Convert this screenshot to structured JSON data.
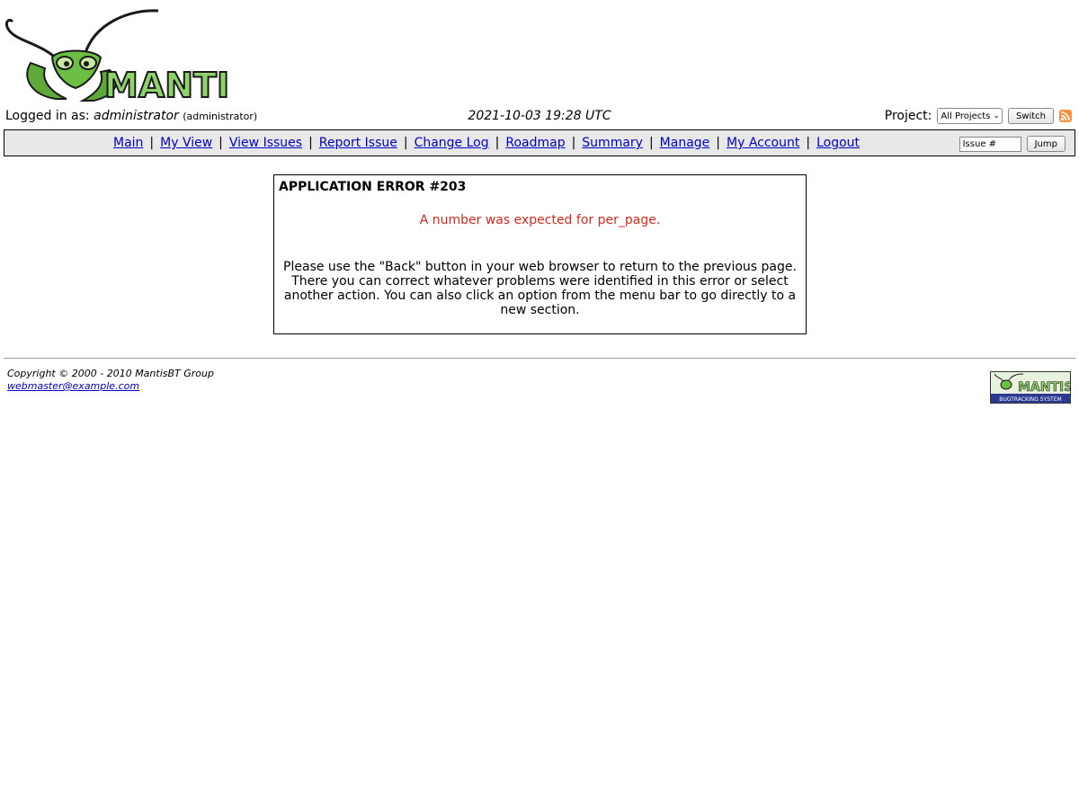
{
  "logo": {
    "text": "MANTIS"
  },
  "login": {
    "prefix": "Logged in as:",
    "username": "administrator",
    "role": "(administrator)"
  },
  "datetime": "2021-10-03 19:28 UTC",
  "project": {
    "label": "Project:",
    "selected": "All Projects",
    "switch_label": "Switch"
  },
  "menu": {
    "items": [
      {
        "label": "Main"
      },
      {
        "label": "My View"
      },
      {
        "label": "View Issues"
      },
      {
        "label": "Report Issue"
      },
      {
        "label": "Change Log"
      },
      {
        "label": "Roadmap"
      },
      {
        "label": "Summary"
      },
      {
        "label": "Manage"
      },
      {
        "label": "My Account"
      },
      {
        "label": "Logout"
      }
    ],
    "separator": "|",
    "issue_placeholder": "Issue #",
    "jump_label": "Jump"
  },
  "error": {
    "title": "APPLICATION ERROR #203",
    "message": "A number was expected for per_page.",
    "help": "Please use the \"Back\" button in your web browser to return to the previous page. There you can correct whatever problems were identified in this error or select another action. You can also click an option from the menu bar to go directly to a new section."
  },
  "footer": {
    "copyright": "Copyright © 2000 - 2010 MantisBT Group",
    "email": "webmaster@example.com",
    "badge_text": "MANTIS",
    "badge_subtext": "BUGTRACKING SYSTEM"
  },
  "colors": {
    "menu_bg": "#e8e8e8",
    "error_red": "#d62a1e",
    "link_blue": "#0000cc",
    "mantis_green": "#5fa83a",
    "badge_blue": "#2b3990"
  }
}
